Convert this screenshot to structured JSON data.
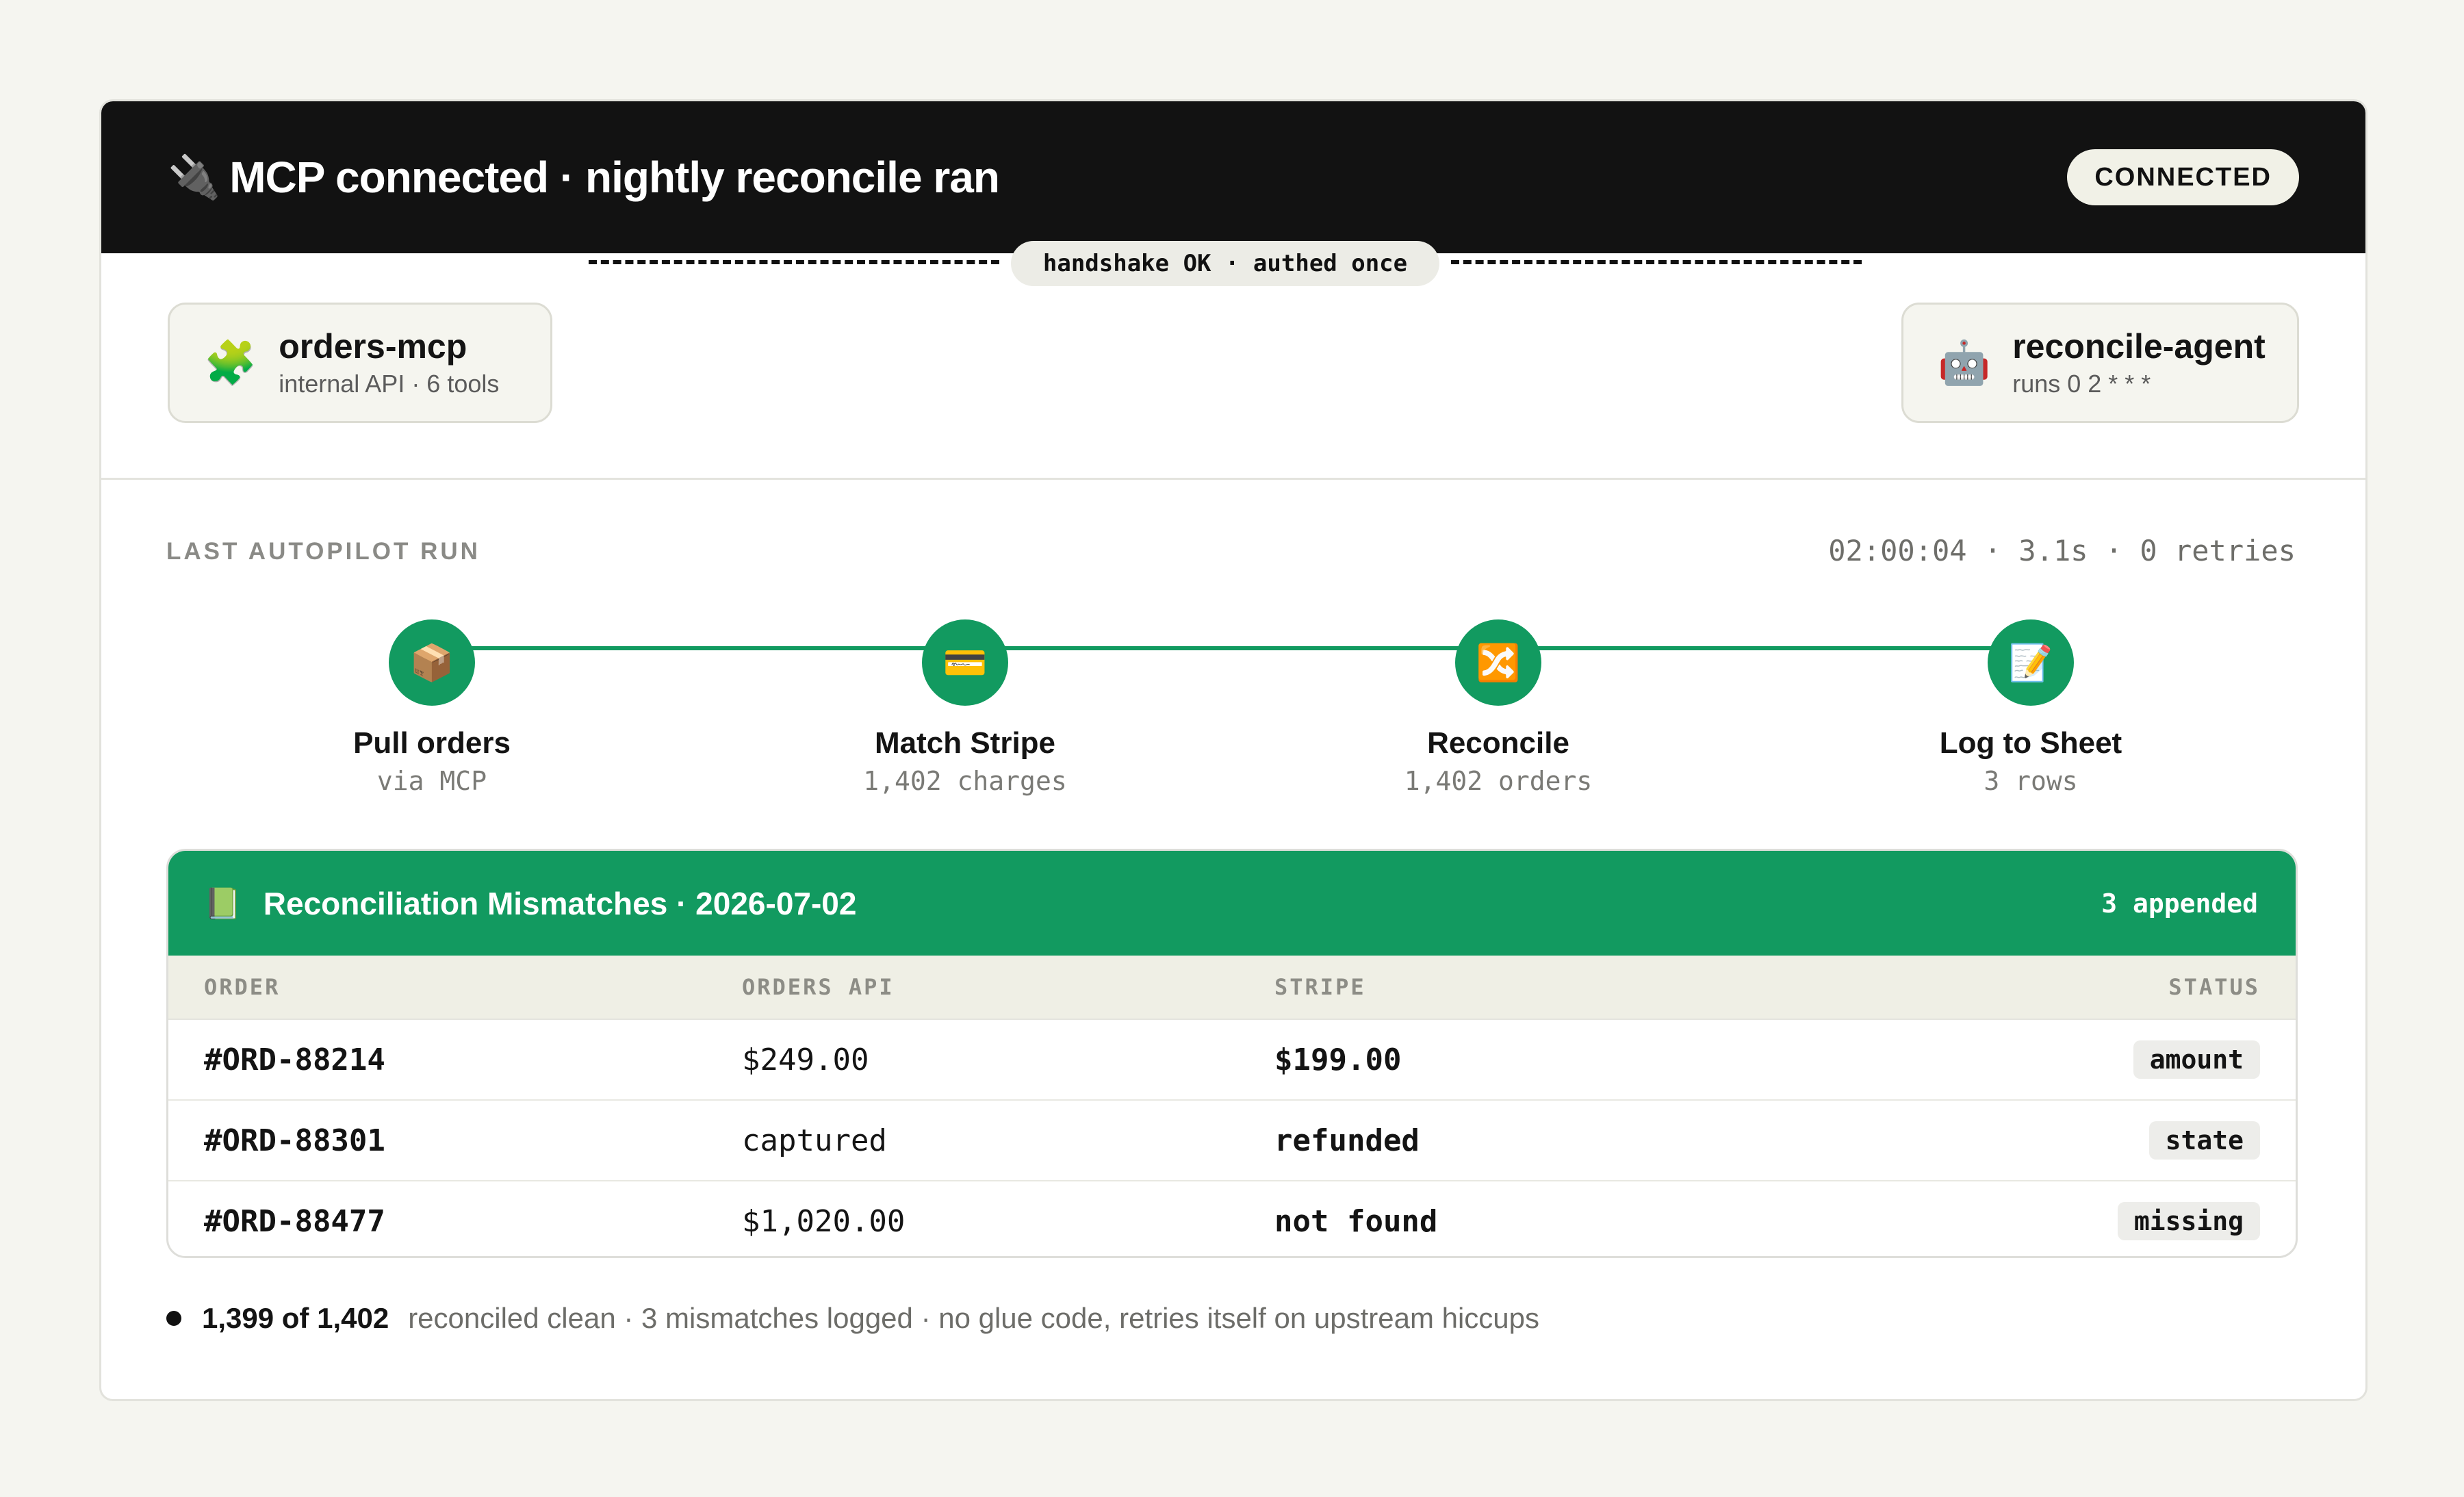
{
  "header": {
    "icon": "plug-icon",
    "title": "MCP connected · nightly reconcile ran",
    "badge": "CONNECTED"
  },
  "connection": {
    "source": {
      "icon": "puzzle-icon",
      "name": "orders-mcp",
      "sub": "internal API · 6 tools"
    },
    "handshake": "handshake OK · authed once",
    "target": {
      "icon": "robot-icon",
      "name": "reconcile-agent",
      "sub": "runs 0 2 * * *"
    }
  },
  "run": {
    "label": "LAST AUTOPILOT RUN",
    "meta": "02:00:04 · 3.1s · 0 retries",
    "steps": [
      {
        "icon": "package-icon",
        "title": "Pull orders",
        "sub": "via MCP"
      },
      {
        "icon": "credit-card-icon",
        "title": "Match Stripe",
        "sub": "1,402 charges"
      },
      {
        "icon": "shuffle-icon",
        "title": "Reconcile",
        "sub": "1,402 orders"
      },
      {
        "icon": "memo-icon",
        "title": "Log to Sheet",
        "sub": "3 rows"
      }
    ]
  },
  "table": {
    "icon": "ledger-icon",
    "title": "Reconciliation Mismatches · 2026-07-02",
    "appended": "3 appended",
    "columns": [
      "ORDER",
      "ORDERS API",
      "STRIPE",
      "STATUS"
    ],
    "rows": [
      {
        "order": "#ORD-88214",
        "api": "$249.00",
        "stripe": "$199.00",
        "status": "amount"
      },
      {
        "order": "#ORD-88301",
        "api": "captured",
        "stripe": "refunded",
        "status": "state"
      },
      {
        "order": "#ORD-88477",
        "api": "$1,020.00",
        "stripe": "not found",
        "status": "missing"
      }
    ]
  },
  "footer": {
    "strong": "1,399 of 1,402",
    "rest": "reconciled clean · 3 mismatches logged · no glue code, retries itself on upstream hiccups"
  },
  "colors": {
    "accent": "#129a60",
    "header_bg": "#121212",
    "page_bg": "#f5f5f0"
  }
}
